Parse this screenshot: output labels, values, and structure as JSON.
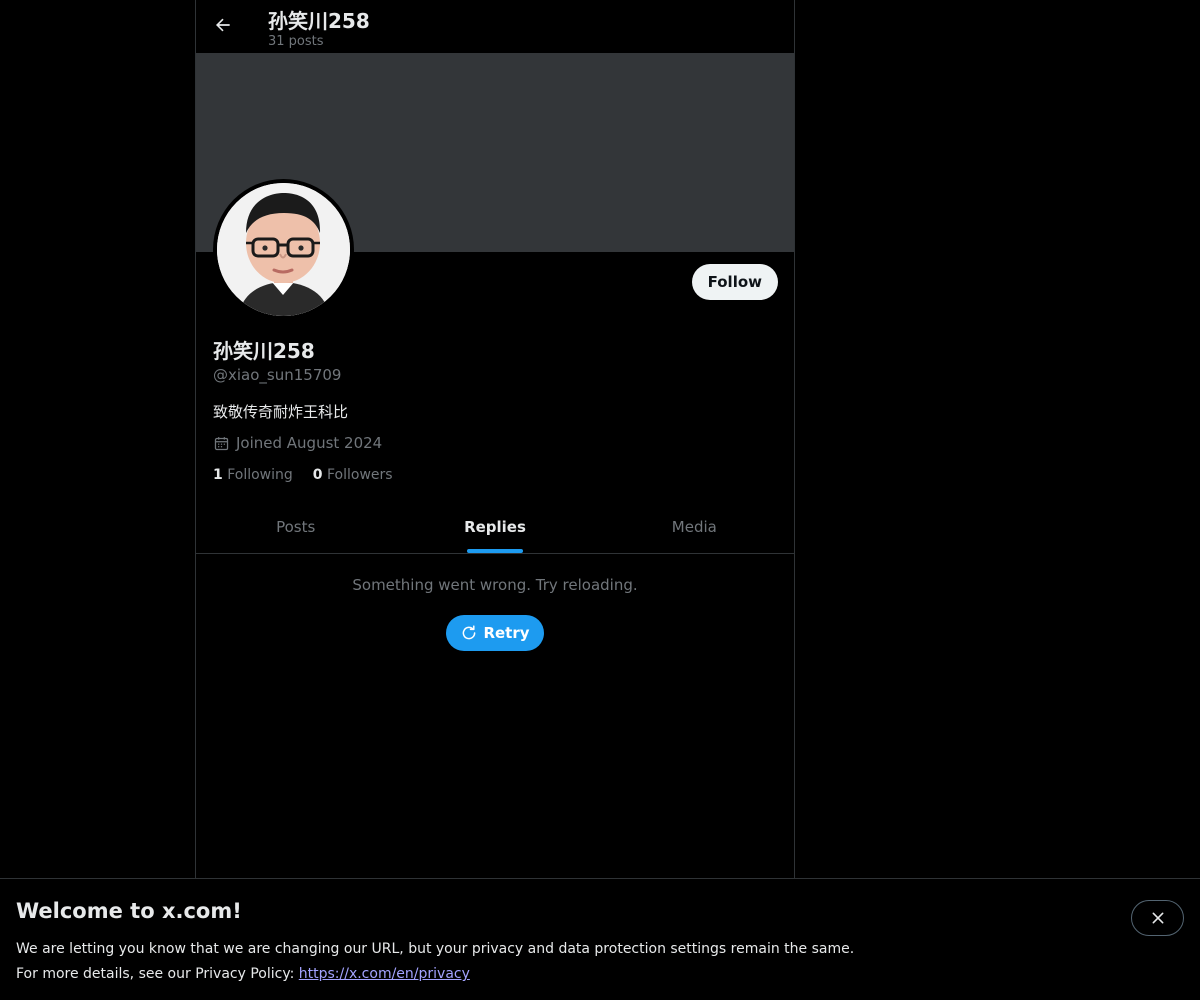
{
  "header": {
    "title": "孙笑川258",
    "post_count": "31 posts"
  },
  "profile": {
    "display_name": "孙笑川258",
    "handle": "@xiao_sun15709",
    "bio": "致敬传奇耐炸王科比",
    "joined": "Joined August 2024",
    "following_count": "1",
    "following_label": "Following",
    "followers_count": "0",
    "followers_label": "Followers",
    "follow_label": "Follow"
  },
  "tabs": [
    {
      "label": "Posts",
      "active": false
    },
    {
      "label": "Replies",
      "active": true
    },
    {
      "label": "Media",
      "active": false
    }
  ],
  "feed": {
    "error_message": "Something went wrong. Try reloading.",
    "retry_label": "Retry"
  },
  "notice": {
    "title": "Welcome to x.com!",
    "line1": "We are letting you know that we are changing our URL, but your privacy and data protection settings remain the same.",
    "line2_prefix": "For more details, see our Privacy Policy:",
    "link": "https://x.com/en/privacy"
  },
  "colors": {
    "accent": "#1d9bf0",
    "background": "#000000",
    "banner": "#333639",
    "muted_text": "#71767b"
  },
  "icons": {
    "back": "arrow-left-icon",
    "calendar": "calendar-icon",
    "retry": "refresh-icon",
    "close": "close-icon"
  }
}
